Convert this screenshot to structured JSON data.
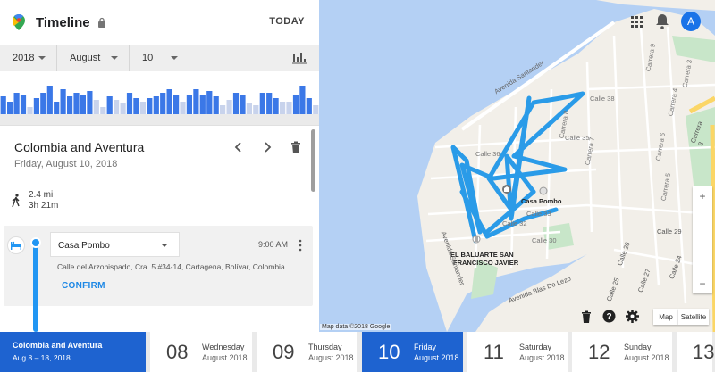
{
  "header": {
    "title": "Timeline",
    "today_label": "TODAY"
  },
  "date_selector": {
    "year": "2018",
    "month": "August",
    "day": "10"
  },
  "histogram": {
    "values": [
      0.5,
      0.35,
      0.6,
      0.55,
      0.2,
      0.45,
      0.6,
      0.8,
      0.35,
      0.7,
      0.5,
      0.6,
      0.55,
      0.65,
      0.4,
      0.2,
      0.5,
      0.4,
      0.3,
      0.6,
      0.45,
      0.35,
      0.45,
      0.5,
      0.6,
      0.7,
      0.55,
      0.35,
      0.55,
      0.7,
      0.55,
      0.65,
      0.5,
      0.25,
      0.4,
      0.6,
      0.55,
      0.3,
      0.25,
      0.6,
      0.6,
      0.45,
      0.35,
      0.35,
      0.55,
      0.8,
      0.45,
      0.25
    ],
    "highlighted": [
      1,
      1,
      1,
      1,
      0,
      1,
      1,
      1,
      1,
      1,
      1,
      1,
      1,
      1,
      0,
      0,
      1,
      0,
      0,
      1,
      1,
      0,
      1,
      1,
      1,
      1,
      1,
      0,
      1,
      1,
      1,
      1,
      1,
      0,
      0,
      1,
      1,
      0,
      0,
      1,
      1,
      1,
      0,
      0,
      1,
      1,
      1,
      0
    ]
  },
  "trip_card": {
    "title": "Colombia and Aventura",
    "date": "Friday, August 10, 2018",
    "distance": "2.4 mi",
    "duration": "3h 21m"
  },
  "visit": {
    "place": "Casa Pombo",
    "time": "9:00 AM",
    "address": "Calle del Arzobispado, Cra. 5 #34-14, Cartagena, Bolívar, Colombia",
    "confirm_label": "CONFIRM"
  },
  "map": {
    "attribution": "Map data ©2018 Google",
    "labels": {
      "casa_pombo": "Casa Pombo",
      "baluarte_1": "EL BALUARTE SAN",
      "baluarte_2": "FRANCISCO JAVIER",
      "avenida_santander": "Avenida Santander",
      "avenida_santander_2": "Avenida Santander",
      "avenida_blas": "Avenida Blas De Lezo",
      "carrera3": "Carrera 3",
      "carrera3_b": "Carrera 3",
      "calle36": "Calle 36",
      "calle32": "Calle 32",
      "calle30": "Calle 30",
      "calle38": "Calle 38",
      "calle25": "Calle 25",
      "calle26": "Calle 26",
      "calle24": "Calle 24",
      "calle29": "Calle 29",
      "calle27": "Calle 27",
      "carrera9": "Carrera 9",
      "carrera8": "Carrera 8",
      "carrera7": "Carrera 7",
      "carrera6": "Carrera 6",
      "carrera5": "Carrera 5",
      "carrera4": "Carrera 4",
      "calle33": "Calle 33",
      "calle35": "Calle 35"
    },
    "buttons": {
      "map": "Map",
      "satellite": "Satellite"
    }
  },
  "colors": {
    "accent": "#1e63d0",
    "route": "#2a9be8"
  },
  "date_strip": {
    "trip": {
      "title": "Colombia and Aventura",
      "range": "Aug 8 – 18, 2018"
    },
    "days": [
      {
        "num": "08",
        "weekday": "Wednesday",
        "month": "August 2018",
        "selected": false
      },
      {
        "num": "09",
        "weekday": "Thursday",
        "month": "August 2018",
        "selected": false
      },
      {
        "num": "10",
        "weekday": "Friday",
        "month": "August 2018",
        "selected": true
      },
      {
        "num": "11",
        "weekday": "Saturday",
        "month": "August 2018",
        "selected": false
      },
      {
        "num": "12",
        "weekday": "Sunday",
        "month": "August 2018",
        "selected": false
      },
      {
        "num": "13",
        "weekday": "",
        "month": "",
        "selected": false
      }
    ]
  },
  "account": {
    "avatar_letter": "A"
  }
}
